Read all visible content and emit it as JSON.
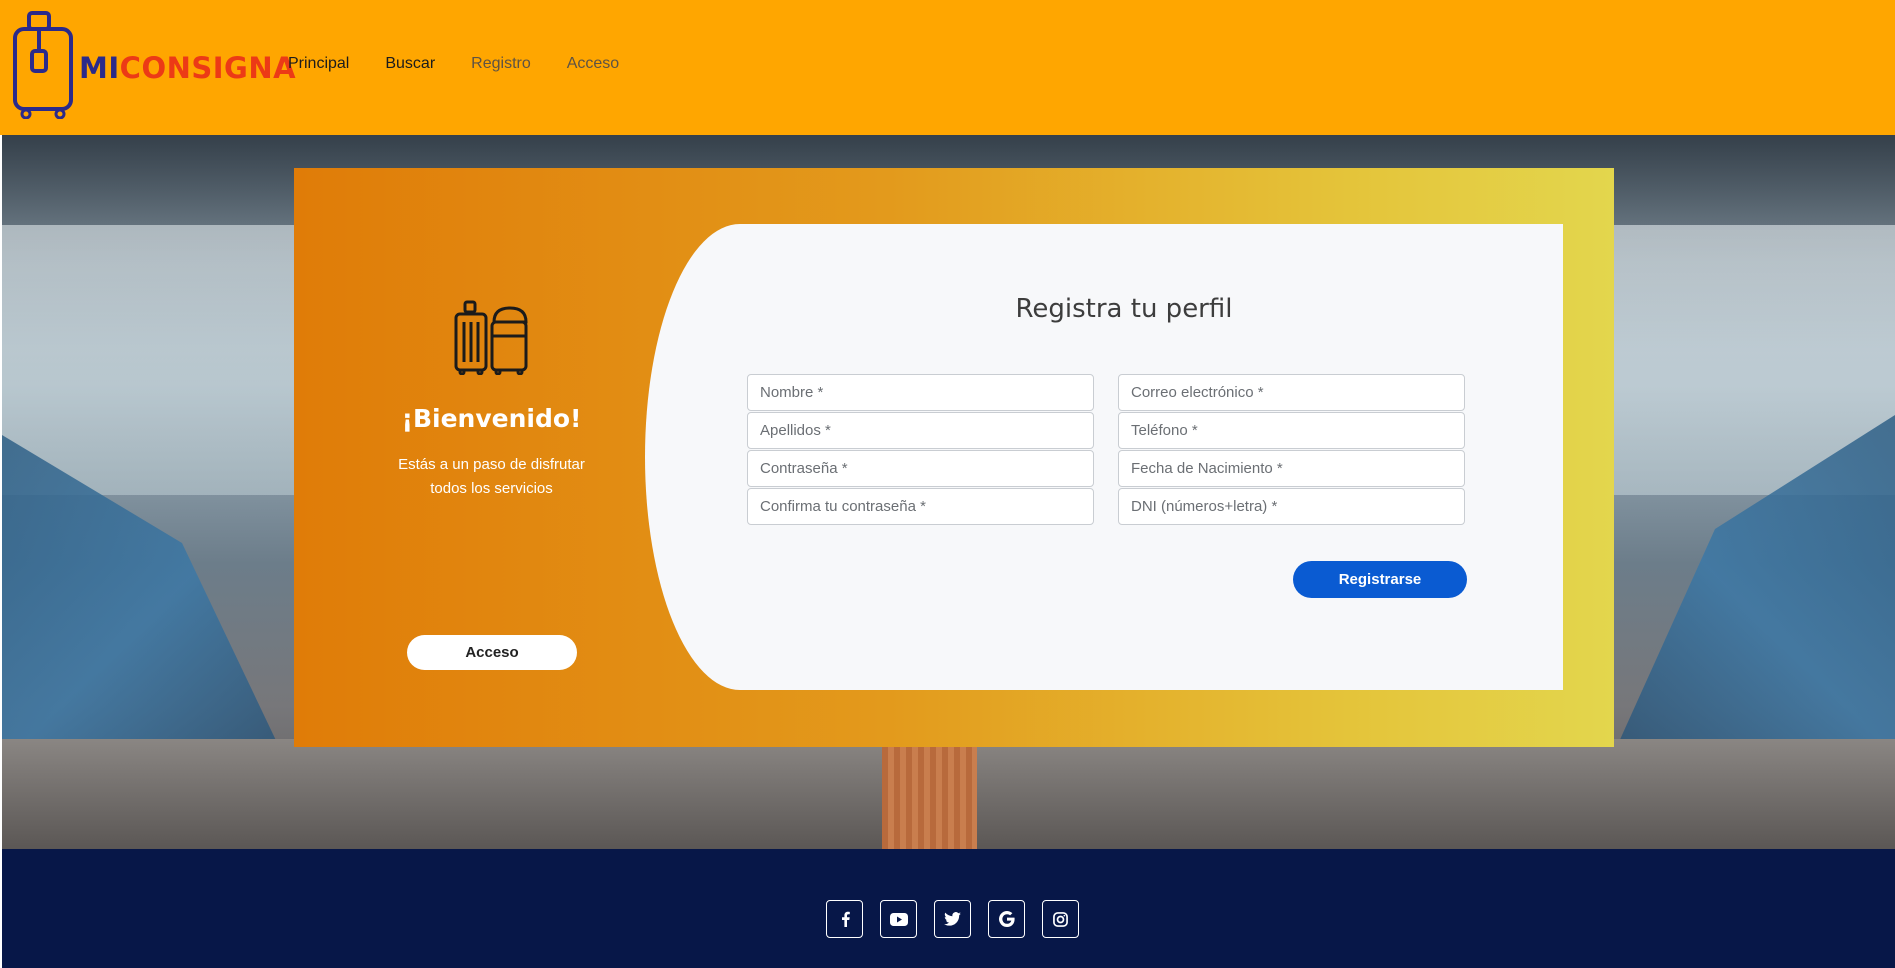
{
  "brand": {
    "mi": "MI",
    "consigna": "CONSIGNA"
  },
  "nav": [
    {
      "label": "Principal",
      "icon": ""
    },
    {
      "label": "Buscar"
    },
    {
      "label": "Registro"
    },
    {
      "label": "Acceso"
    }
  ],
  "welcome": {
    "icon": "luggage-icon",
    "title": "¡Bienvenido!",
    "text": "Estás a un paso de disfrutar todos los servicios",
    "login_button": "Acceso"
  },
  "form": {
    "title": "Registra tu perfil",
    "fields": {
      "nombre": {
        "placeholder": "Nombre *"
      },
      "apellidos": {
        "placeholder": "Apellidos *"
      },
      "password": {
        "placeholder": "Contraseña *"
      },
      "password_confirm": {
        "placeholder": "Confirma tu contraseña *"
      },
      "email": {
        "placeholder": "Correo electrónico *"
      },
      "telefono": {
        "placeholder": "Teléfono *"
      },
      "nacimiento": {
        "placeholder": "Fecha de Nacimiento *"
      },
      "dni": {
        "placeholder": "DNI (números+letra) *"
      }
    },
    "submit": "Registrarse"
  },
  "footer": {
    "social": [
      "facebook-icon",
      "youtube-icon",
      "twitter-icon",
      "google-icon",
      "instagram-icon"
    ]
  },
  "colors": {
    "header": "#ffa600",
    "footer": "#071748",
    "primary_button": "#0a5bd2",
    "logo_mi": "#2b2a8a",
    "logo_consigna": "#ec3a16"
  }
}
